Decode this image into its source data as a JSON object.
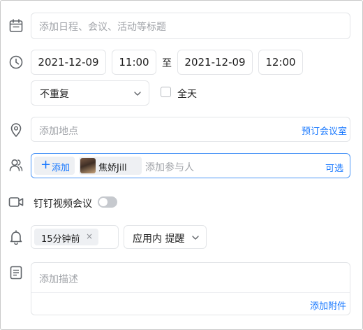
{
  "title": {
    "placeholder": "添加日程、会议、活动等标题"
  },
  "time": {
    "start_date": "2021-12-09",
    "start_time": "11:00",
    "separator": "至",
    "end_date": "2021-12-09",
    "end_time": "12:00",
    "repeat": "不重复",
    "all_day_label": "全天",
    "all_day_checked": false
  },
  "location": {
    "placeholder": "添加地点",
    "book_room_link": "预订会议室"
  },
  "participants": {
    "add_button": "添加",
    "chips": [
      {
        "name": "焦娇Jill"
      }
    ],
    "placeholder": "添加参与人",
    "optional_link": "可选"
  },
  "video": {
    "label": "钉钉视频会议",
    "enabled": false
  },
  "reminder": {
    "chip": "15分钟前",
    "remove_glyph": "×",
    "mode": "应用内 提醒"
  },
  "description": {
    "placeholder": "添加描述",
    "attach_link": "添加附件"
  },
  "colors": {
    "accent": "#1677ff",
    "border": "#e3e5e8",
    "icon": "#5f6368",
    "placeholder": "#a0a3a8"
  }
}
